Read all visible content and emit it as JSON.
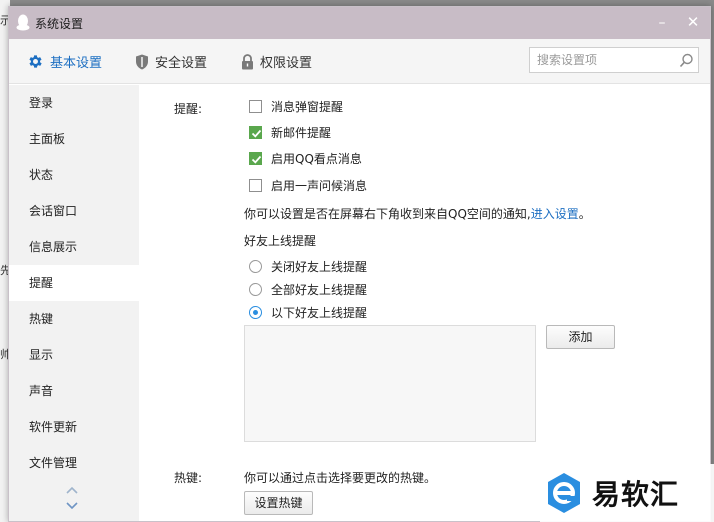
{
  "background": {
    "glyphs": [
      "示",
      "先",
      "帅"
    ]
  },
  "window": {
    "title": "系统设置",
    "minimize_symbol": "–",
    "close_symbol": "✕"
  },
  "tabs": [
    {
      "label": "基本设置",
      "icon": "gear-icon",
      "active": true
    },
    {
      "label": "安全设置",
      "icon": "shield-icon",
      "active": false
    },
    {
      "label": "权限设置",
      "icon": "lock-icon",
      "active": false
    }
  ],
  "search": {
    "placeholder": "搜索设置项",
    "value": ""
  },
  "sidebar": {
    "items": [
      {
        "label": "登录"
      },
      {
        "label": "主面板"
      },
      {
        "label": "状态"
      },
      {
        "label": "会话窗口"
      },
      {
        "label": "信息展示"
      },
      {
        "label": "提醒",
        "active": true
      },
      {
        "label": "热键"
      },
      {
        "label": "显示"
      },
      {
        "label": "声音"
      },
      {
        "label": "软件更新"
      },
      {
        "label": "文件管理"
      }
    ]
  },
  "reminder": {
    "label": "提醒:",
    "options": [
      {
        "label": "消息弹窗提醒",
        "checked": false
      },
      {
        "label": "新邮件提醒",
        "checked": true
      },
      {
        "label": "启用QQ看点消息",
        "checked": true
      },
      {
        "label": "启用一声问候消息",
        "checked": false
      }
    ],
    "qzone_notice": "你可以设置是否在屏幕右下角收到来自QQ空间的通知,",
    "qzone_link": "进入设置",
    "qzone_end": "。",
    "friend_online_title": "好友上线提醒",
    "friend_online_options": [
      {
        "label": "关闭好友上线提醒",
        "checked": false
      },
      {
        "label": "全部好友上线提醒",
        "checked": false
      },
      {
        "label": "以下好友上线提醒",
        "checked": true
      }
    ],
    "add_button": "添加"
  },
  "hotkey": {
    "label": "热键:",
    "description": "你可以通过点击选择要更改的热键。",
    "set_button": "设置热键"
  },
  "watermark": {
    "text": "易软汇"
  },
  "colors": {
    "accent": "#1d6fc2",
    "titlebar": "#c8bcc6",
    "checkbox_checked": "#5aa74d",
    "radio_checked": "#2a8ee0"
  }
}
